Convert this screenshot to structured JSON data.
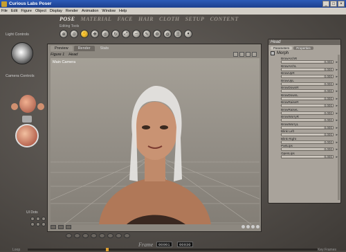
{
  "window": {
    "title": "Curious Labs Poser",
    "controls": [
      "_",
      "□",
      "×"
    ]
  },
  "menu": [
    "File",
    "Edit",
    "Figure",
    "Object",
    "Display",
    "Render",
    "Animation",
    "Window",
    "Help"
  ],
  "room_tabs": [
    {
      "label": "POSE",
      "active": true
    },
    {
      "label": "MATERIAL",
      "active": false
    },
    {
      "label": "FACE",
      "active": false
    },
    {
      "label": "HAIR",
      "active": false
    },
    {
      "label": "CLOTH",
      "active": false
    },
    {
      "label": "SETUP",
      "active": false
    },
    {
      "label": "CONTENT",
      "active": false
    }
  ],
  "editing_tools_label": "Editing Tools",
  "tools": [
    "⊕",
    "⊙",
    "✋",
    "✥",
    "◎",
    "↻",
    "⤢",
    "⇔",
    "✎",
    "⚙",
    "◍",
    "☰",
    "♦"
  ],
  "left": {
    "light_controls": "Light Controls",
    "camera_controls": "Camera Controls",
    "ui_dots": "UI Dots"
  },
  "viewport": {
    "tabs": [
      "Preview",
      "Render"
    ],
    "extra_tab": "Stats",
    "figure_select": "Figure 1",
    "part_select": "Head",
    "camera_label": "Main Camera"
  },
  "param_panel": {
    "title": "Head",
    "tabs": [
      "Parameters",
      "Properties"
    ],
    "group": "Morph",
    "params": [
      {
        "label": "BrowArchR",
        "value": "0.000"
      },
      {
        "label": "BrowArchL",
        "value": "0.000"
      },
      {
        "label": "BrowUpR",
        "value": "0.000"
      },
      {
        "label": "BrowUpL",
        "value": "0.000"
      },
      {
        "label": "BrowDownR",
        "value": "0.000"
      },
      {
        "label": "BrowDownL",
        "value": "0.000"
      },
      {
        "label": "BrowRaiseR",
        "value": "0.000"
      },
      {
        "label": "BrowRaiseL",
        "value": "0.000"
      },
      {
        "label": "BrowWorryR",
        "value": "0.000"
      },
      {
        "label": "BrowWorryL",
        "value": "0.000"
      },
      {
        "label": "Blink Left",
        "value": "0.000"
      },
      {
        "label": "Blink Right",
        "value": "0.000"
      },
      {
        "label": "PartLips",
        "value": "0.000"
      },
      {
        "label": "OpenLips",
        "value": "0.000"
      }
    ]
  },
  "bottom": {
    "frame_label": "Frame",
    "counter_current": "00001",
    "counter_total": "00030",
    "left_side": "Loop",
    "right_side": "Key Frames"
  },
  "colors": {
    "titlebar": "#2d5bb8",
    "menubar": "#d4d0c8",
    "app_bg": "#4a4540",
    "timeline_knob": "#e0a030"
  }
}
